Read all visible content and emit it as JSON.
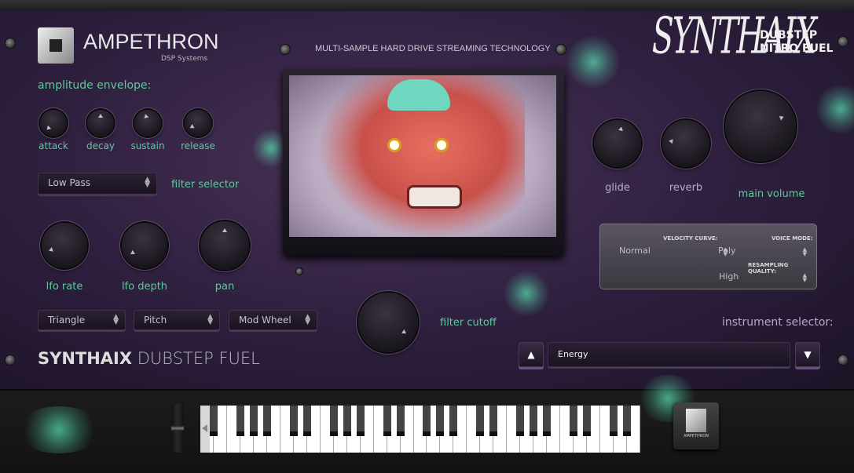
{
  "brand": {
    "name": "AMPETHRON",
    "sub": "DSP Systems"
  },
  "product": {
    "graffiti": "SYNTHAIX",
    "line1": "DUBSTEP",
    "line2": "NITRO FUEL",
    "footer_bold": "SYNTHAIX",
    "footer_light": "DUBSTEP FUEL"
  },
  "tagline": "MULTI-SAMPLE HARD DRIVE STREAMING TECHNOLOGY",
  "envelope": {
    "title": "amplitude envelope:",
    "knobs": [
      {
        "label": "attack",
        "value": 0.0
      },
      {
        "label": "decay",
        "value": 0.5
      },
      {
        "label": "sustain",
        "value": 0.45
      },
      {
        "label": "release",
        "value": 0.05
      }
    ]
  },
  "filter": {
    "selected": "Low Pass",
    "label": "filter selector",
    "cutoff_label": "filter cutoff",
    "cutoff_value": 0.95
  },
  "lfo": {
    "knobs": [
      {
        "label": "lfo rate",
        "value": 0.1
      },
      {
        "label": "lfo depth",
        "value": 0.05
      },
      {
        "label": "pan",
        "value": 0.5
      }
    ],
    "selects": [
      "Triangle",
      "Pitch",
      "Mod Wheel"
    ]
  },
  "fx": {
    "knobs": [
      {
        "label": "glide",
        "value": 0.55
      },
      {
        "label": "reverb",
        "value": 0.2
      },
      {
        "label": "main volume",
        "value": 0.75
      }
    ]
  },
  "settings": {
    "velocity_curve_label": "VELOCITY CURVE:",
    "velocity_curve": "Normal",
    "voice_mode_label": "VOICE MODE:",
    "voice_mode": "Poly",
    "resampling_label": "RESAMPLING QUALITY:",
    "resampling": "High"
  },
  "instrument": {
    "label": "instrument selector:",
    "selected": "Energy",
    "up": "▲",
    "down": "▼"
  },
  "keyboard": {
    "white_keys": 33,
    "start_note": "D"
  },
  "logo_button": {
    "text": "AMPETHRON"
  },
  "colors": {
    "accent_green": "#5fc99a",
    "panel_purple": "#2f2040"
  }
}
